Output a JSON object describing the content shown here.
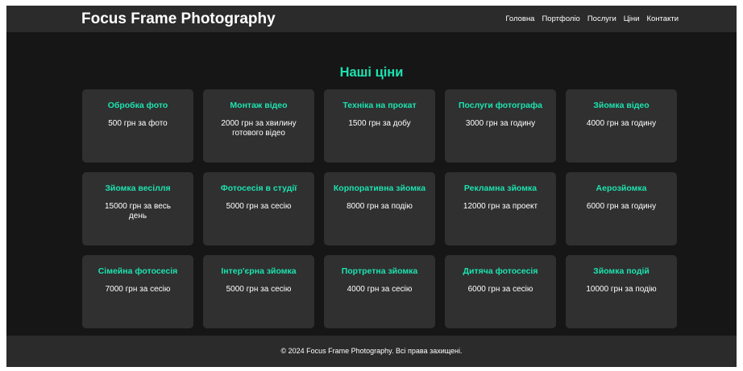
{
  "header": {
    "brand": "Focus Frame Photography",
    "nav": [
      "Головна",
      "Портфоліо",
      "Послуги",
      "Ціни",
      "Контакти"
    ]
  },
  "pricing": {
    "title": "Наші ціни",
    "cards": [
      {
        "title": "Обробка фото",
        "price": "500 грн за фото"
      },
      {
        "title": "Монтаж відео",
        "price": "2000 грн за хвилину готового відео"
      },
      {
        "title": "Техніка на прокат",
        "price": "1500 грн за добу"
      },
      {
        "title": "Послуги фотографа",
        "price": "3000 грн за годину"
      },
      {
        "title": "Зйомка відео",
        "price": "4000 грн за годину"
      },
      {
        "title": "Зйомка весілля",
        "price": "15000 грн за весь день"
      },
      {
        "title": "Фотосесія в студії",
        "price": "5000 грн за сесію"
      },
      {
        "title": "Корпоративна зйомка",
        "price": "8000 грн за подію"
      },
      {
        "title": "Рекламна зйомка",
        "price": "12000 грн за проект"
      },
      {
        "title": "Аерозйомка",
        "price": "6000 грн за годину"
      },
      {
        "title": "Сімейна фотосесія",
        "price": "7000 грн за сесію"
      },
      {
        "title": "Інтер'єрна зйомка",
        "price": "5000 грн за сесію"
      },
      {
        "title": "Портретна зйомка",
        "price": "4000 грн за сесію"
      },
      {
        "title": "Дитяча фотосесія",
        "price": "6000 грн за сесію"
      },
      {
        "title": "Зйомка подій",
        "price": "10000 грн за подію"
      }
    ]
  },
  "footer": {
    "text": "© 2024 Focus Frame Photography. Всі права захищені."
  },
  "colors": {
    "accent": "#1de3b0",
    "background": "#161616",
    "header_bg": "#2b2b2b",
    "card_bg": "#303030"
  }
}
